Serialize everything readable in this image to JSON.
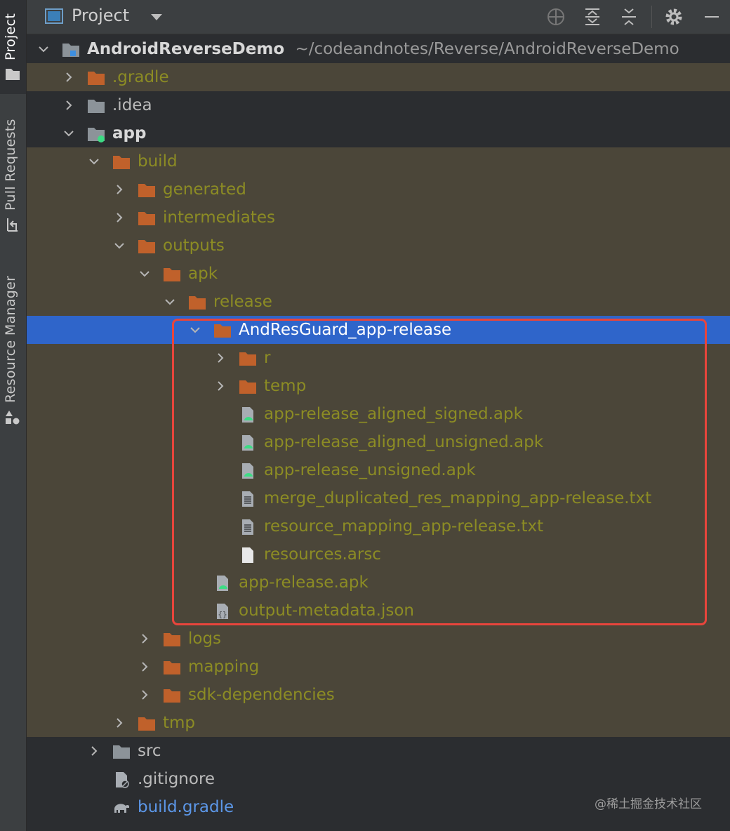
{
  "side_tabs": {
    "project": "Project",
    "pull_requests": "Pull Requests",
    "resource_manager": "Resource Manager"
  },
  "header": {
    "title": "Project",
    "icons": [
      "project-view-icon",
      "chevron-down-icon",
      "locate-icon",
      "expand-all-icon",
      "collapse-all-icon",
      "gear-icon",
      "minimize-icon"
    ]
  },
  "root": {
    "name": "AndroidReverseDemo",
    "path": "~/codeandnotes/Reverse/AndroidReverseDemo"
  },
  "tree": {
    "gradle": ".gradle",
    "idea": ".idea",
    "app": "app",
    "build": "build",
    "generated": "generated",
    "intermediates": "intermediates",
    "outputs": "outputs",
    "apk": "apk",
    "release": "release",
    "andresguard": "AndResGuard_app-release",
    "r": "r",
    "temp": "temp",
    "f1": "app-release_aligned_signed.apk",
    "f2": "app-release_aligned_unsigned.apk",
    "f3": "app-release_unsigned.apk",
    "f4": "merge_duplicated_res_mapping_app-release.txt",
    "f5": "resource_mapping_app-release.txt",
    "f6": "resources.arsc",
    "app_apk": "app-release.apk",
    "metadata": "output-metadata.json",
    "logs": "logs",
    "mapping": "mapping",
    "sdkdeps": "sdk-dependencies",
    "tmp": "tmp",
    "src": "src",
    "gitignore": ".gitignore",
    "buildgradle": "build.gradle"
  },
  "watermark": "@稀土掘金技术社区",
  "colors": {
    "excluded_bg": "#4b4639",
    "selected_bg": "#2f65ca",
    "excluded_text": "#8c8c24",
    "folder_orange": "#c0612b",
    "highlight_border": "#e8453c"
  }
}
